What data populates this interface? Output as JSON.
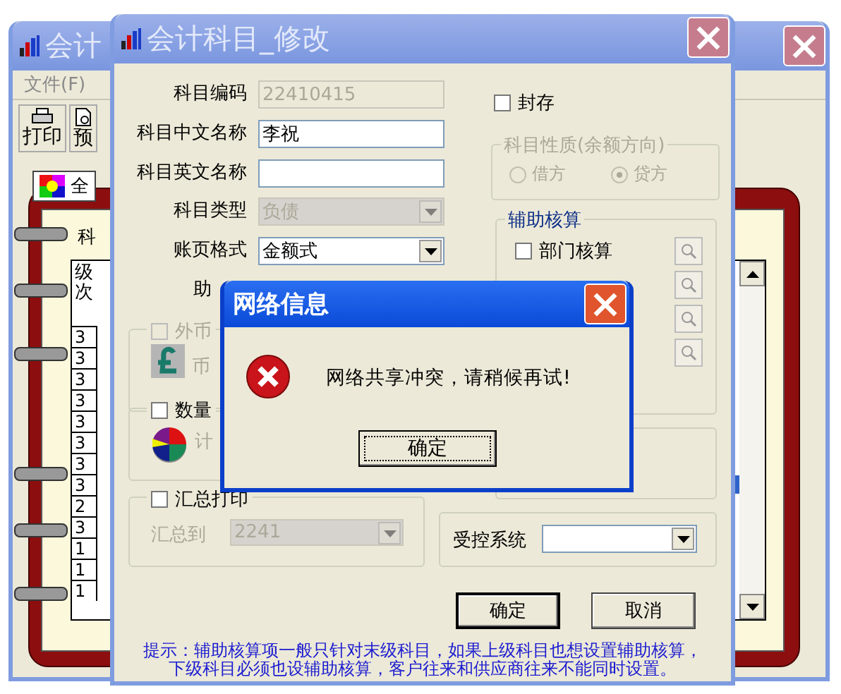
{
  "back_window": {
    "title": "会计",
    "menu": [
      "文件(F)"
    ],
    "toolbar": [
      "打印",
      "预"
    ],
    "tab": "全",
    "caption": "科",
    "table": {
      "column": "级次",
      "rows": [
        "3",
        "3",
        "3",
        "3",
        "3",
        "3",
        "3",
        "3",
        "2",
        "3",
        "1",
        "1",
        "1"
      ]
    }
  },
  "dialog": {
    "title": "会计科目_修改",
    "fields": [
      {
        "label": "科目编码",
        "kind": "text",
        "value": "22410415",
        "disabled": true
      },
      {
        "label": "科目中文名称",
        "kind": "text",
        "value": "李祝",
        "disabled": false
      },
      {
        "label": "科目英文名称",
        "kind": "text",
        "disabled": false
      },
      {
        "label": "科目类型",
        "kind": "select",
        "value": "负债",
        "disabled": true
      },
      {
        "label": "账页格式",
        "kind": "select",
        "value": "金额式",
        "disabled": false
      },
      {
        "label": "助",
        "kind": "hidden"
      }
    ],
    "sealed": {
      "label": "封存",
      "checked": false
    },
    "nature": {
      "title": "科目性质(余额方向)",
      "disabled": true,
      "options": [
        {
          "label": "借方",
          "selected": false
        },
        {
          "label": "贷方",
          "selected": true
        }
      ]
    },
    "auxiliary": {
      "title": "辅助核算",
      "items": [
        {
          "label": "部门核算",
          "checked": false
        }
      ]
    },
    "foreign": {
      "label": "外币",
      "checked": false,
      "disabled": true,
      "sub": "币"
    },
    "quantity": {
      "label": "数量",
      "checked": false,
      "disabled": false,
      "sub": "计"
    },
    "summary": {
      "label": "汇总打印",
      "checked": false,
      "target_label": "汇总到",
      "target": "2241",
      "disabled": true
    },
    "controlled": {
      "label": "受控系统"
    },
    "buttons": [
      "确定",
      "取消"
    ],
    "hint": [
      "提示：辅助核算项一般只针对末级科目，如果上级科目也想设置辅助核算，",
      "下级科目必须也设辅助核算，客户往来和供应商往来不能同时设置。"
    ]
  },
  "message": {
    "title": "网络信息",
    "text": "网络共享冲突，请稍候再试!",
    "button": "确定"
  }
}
